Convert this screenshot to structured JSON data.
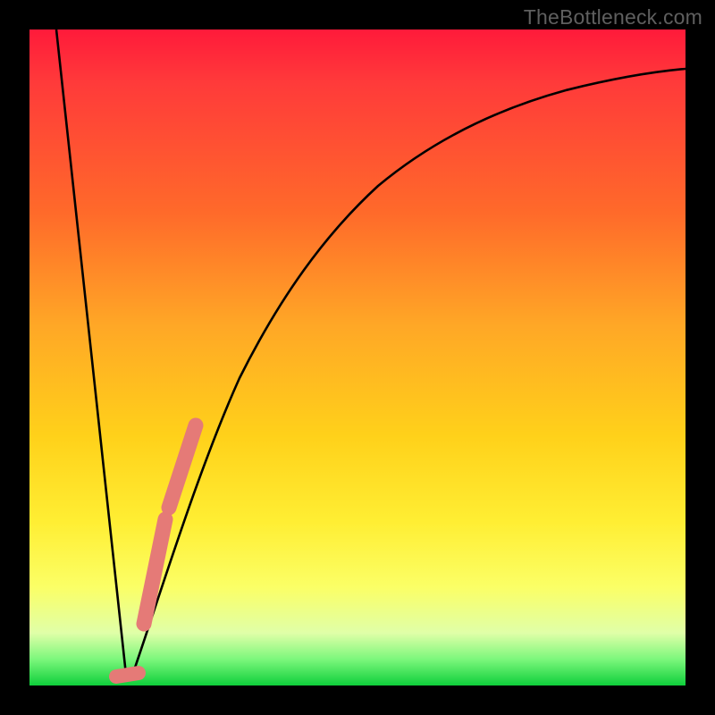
{
  "watermark": "TheBottleneck.com",
  "colors": {
    "frame": "#000000",
    "curve": "#000000",
    "marker": "#e57a77",
    "gradient_stops": [
      "#ff1a3a",
      "#ff6a2a",
      "#ffd11a",
      "#fbff66",
      "#0fcf3b"
    ]
  },
  "chart_data": {
    "type": "line",
    "title": "",
    "xlabel": "",
    "ylabel": "",
    "xlim": [
      0,
      100
    ],
    "ylim": [
      0,
      100
    ],
    "grid": false,
    "legend": false,
    "series": [
      {
        "name": "bottleneck-curve",
        "x": [
          4,
          6,
          8,
          10,
          12,
          13,
          14,
          15,
          16,
          18,
          20,
          22,
          25,
          28,
          32,
          36,
          40,
          45,
          50,
          55,
          60,
          65,
          70,
          75,
          80,
          85,
          90,
          95,
          100
        ],
        "y": [
          100,
          83,
          66,
          49,
          32,
          16,
          3,
          1,
          3,
          14,
          24,
          33,
          43,
          51,
          59,
          65,
          70,
          75,
          79,
          82,
          84.5,
          86.5,
          88,
          89.2,
          90.2,
          91,
          91.7,
          92.2,
          92.6
        ]
      }
    ],
    "markers": [
      {
        "name": "highlight-segment-upper",
        "x_range": [
          21,
          24
        ],
        "y_range": [
          28,
          40
        ],
        "color": "#e57a77"
      },
      {
        "name": "highlight-segment-lower",
        "x_range": [
          17,
          21
        ],
        "y_range": [
          9,
          28
        ],
        "color": "#e57a77"
      },
      {
        "name": "highlight-min",
        "x_range": [
          13.5,
          16
        ],
        "y_range": [
          0.5,
          2.5
        ],
        "color": "#e57a77"
      }
    ]
  }
}
